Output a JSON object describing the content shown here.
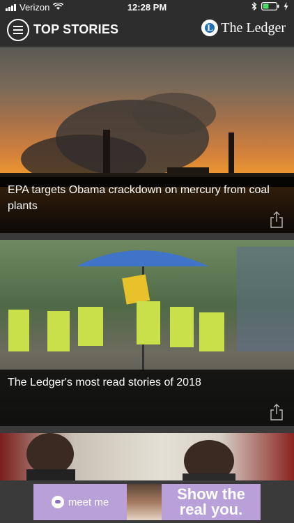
{
  "status_bar": {
    "carrier": "Verizon",
    "time": "12:28 PM",
    "icons": [
      "signal-bars-icon",
      "wifi-icon",
      "bluetooth-icon",
      "battery-icon",
      "charging-bolt-icon"
    ]
  },
  "header": {
    "menu_icon": "hamburger-menu-icon",
    "title": "TOP STORIES",
    "brand": "The Ledger"
  },
  "stories": [
    {
      "headline": "EPA targets Obama crackdown on mercury from coal plants",
      "share_icon": "share-icon"
    },
    {
      "headline": "The Ledger's most read stories of 2018",
      "share_icon": "share-icon"
    },
    {
      "headline": "",
      "share_icon": ""
    }
  ],
  "ad": {
    "brand": "meet me",
    "tagline_line1": "Show the",
    "tagline_line2": "real you."
  },
  "colors": {
    "background": "#3a3a3a",
    "header": "#2d2d2d",
    "text": "#ffffff",
    "ad_purple": "#b9a0d8"
  }
}
